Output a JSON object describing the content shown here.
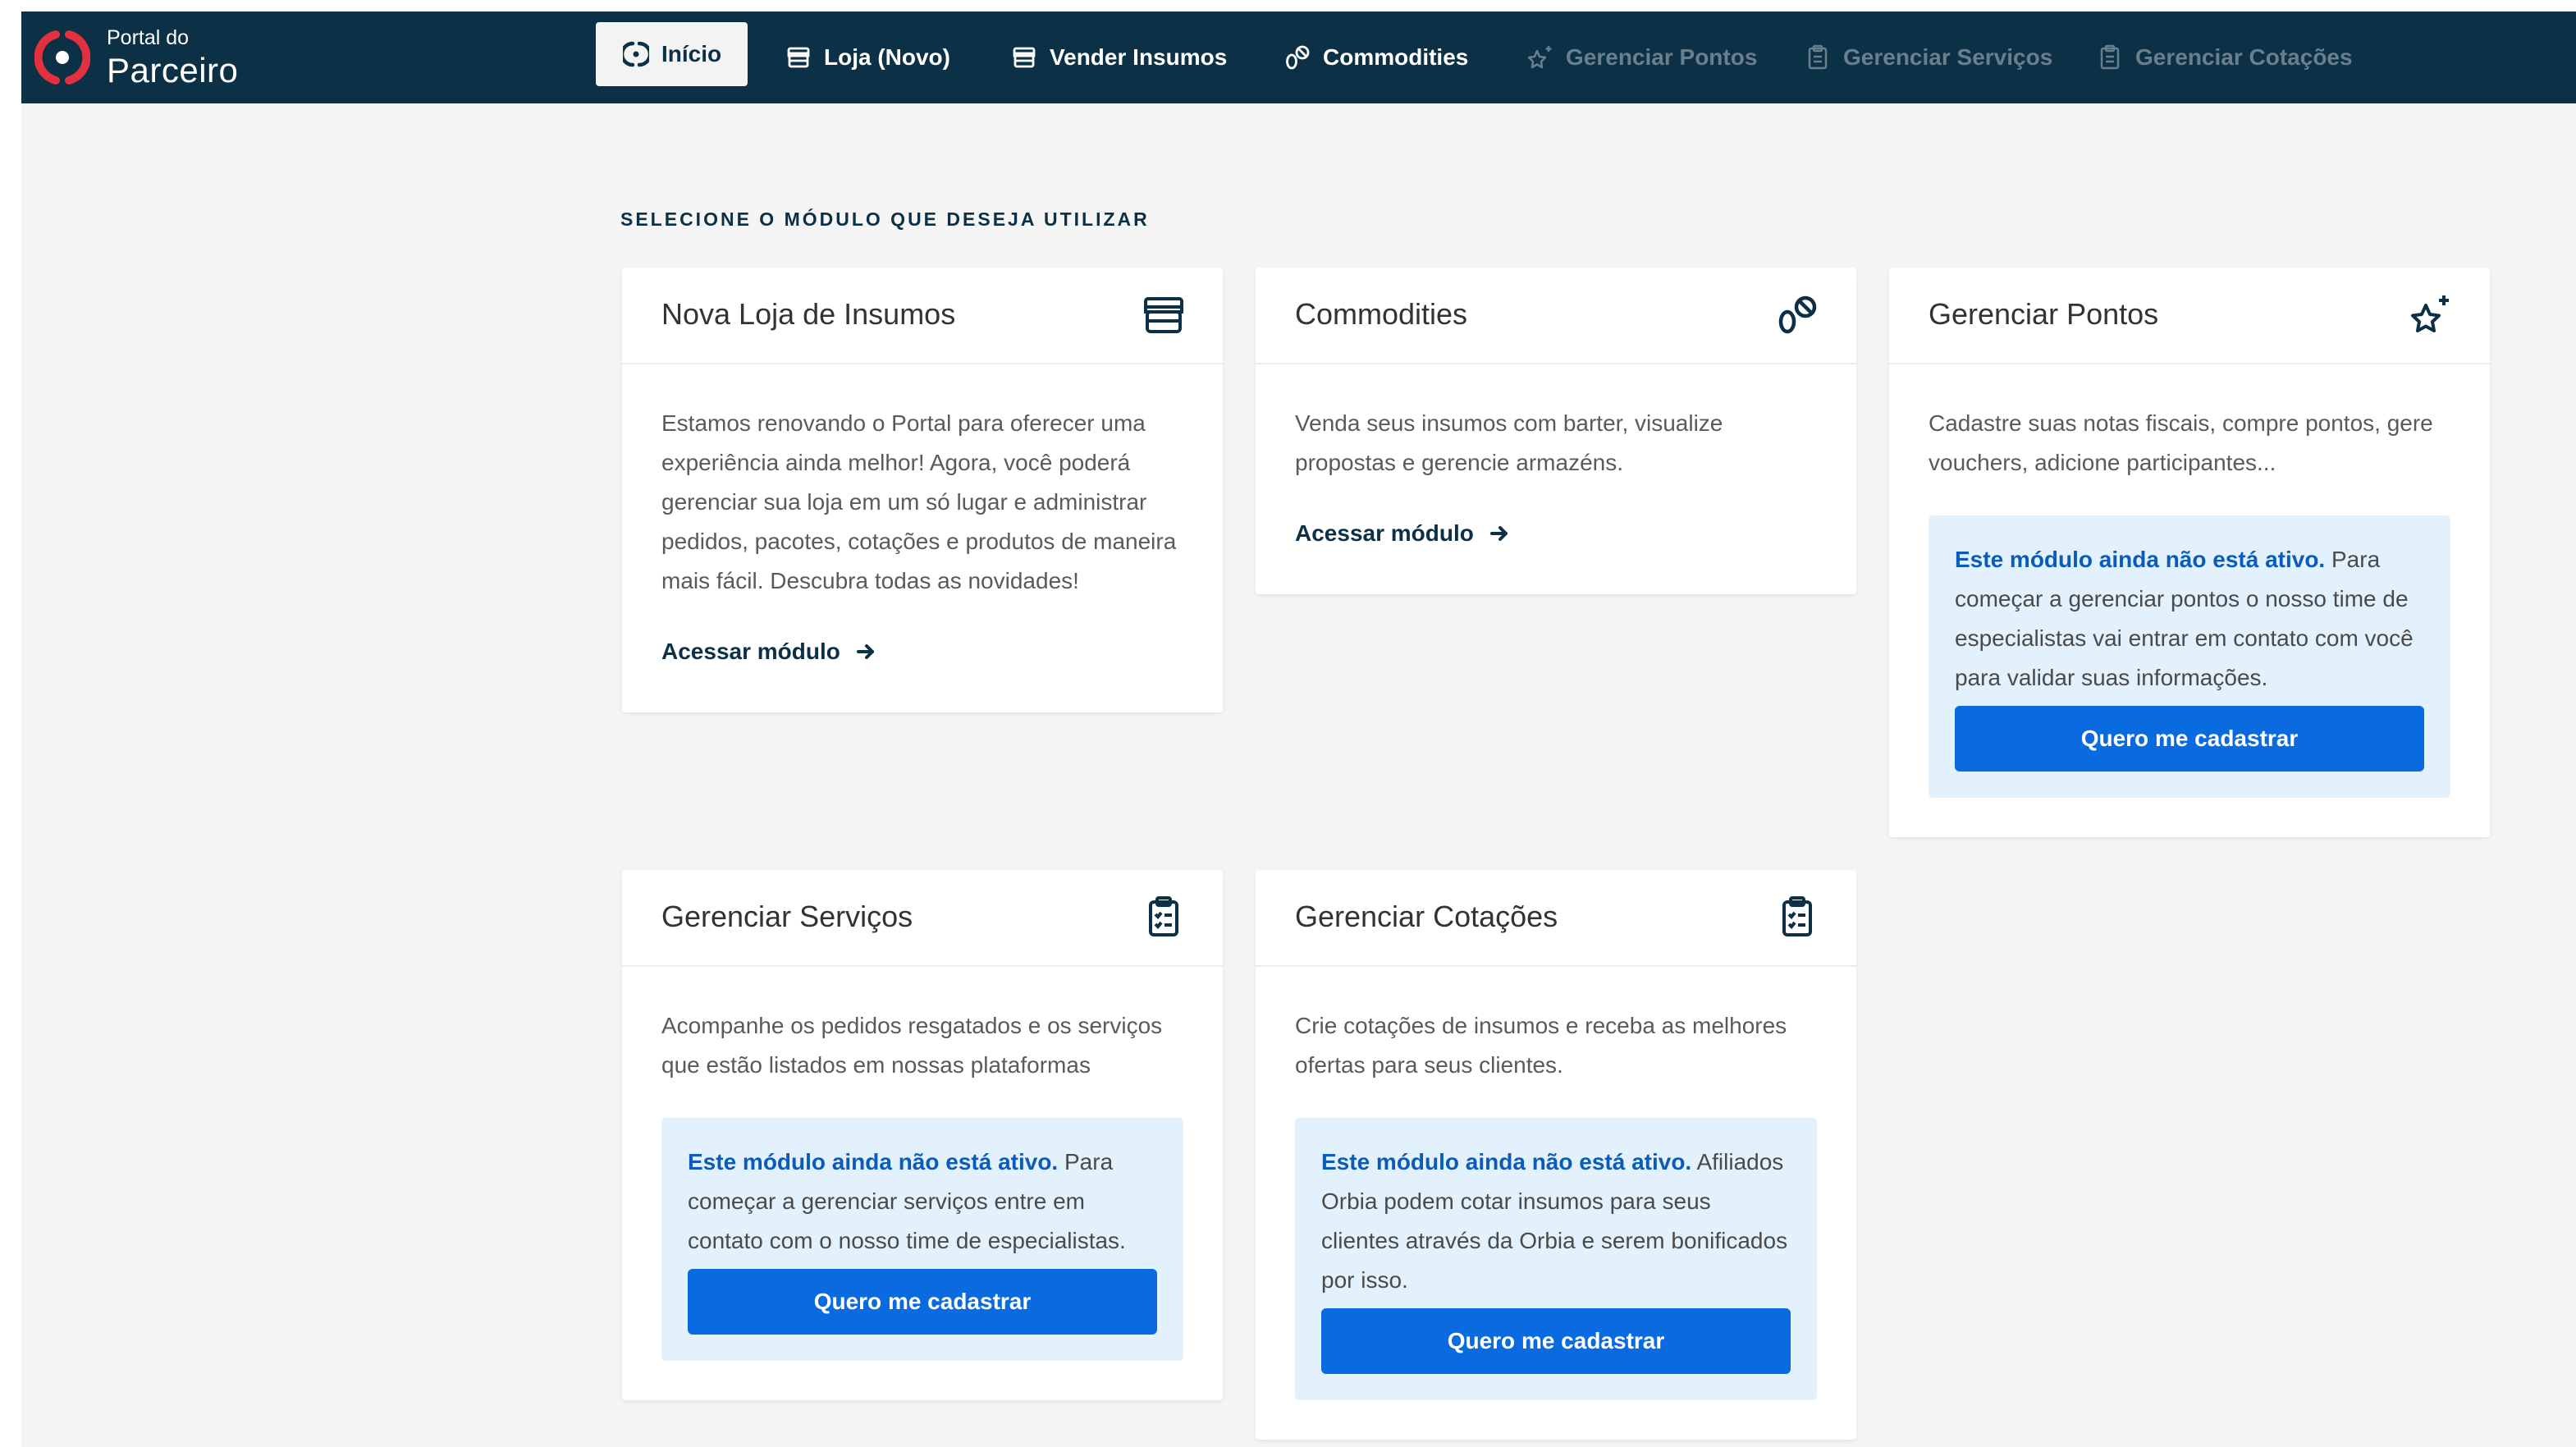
{
  "brand": {
    "small": "Portal do",
    "big": "Parceiro",
    "accent": "#e3303f",
    "nav_bg": "#0c3045"
  },
  "nav": {
    "items": [
      {
        "label": "Início",
        "icon": "orbia-logo-icon",
        "active": true
      },
      {
        "label": "Loja (Novo)",
        "icon": "store-icon"
      },
      {
        "label": "Vender Insumos",
        "icon": "store-icon"
      },
      {
        "label": "Commodities",
        "icon": "coins-icon"
      },
      {
        "label": "Gerenciar Pontos",
        "icon": "sparkle-star-icon",
        "disabled": true
      },
      {
        "label": "Gerenciar Serviços",
        "icon": "clipboard-icon",
        "disabled": true
      },
      {
        "label": "Gerenciar Cotações",
        "icon": "clipboard-icon",
        "disabled": true
      }
    ]
  },
  "main": {
    "section_title": "SELECIONE O MÓDULO QUE DESEJA UTILIZAR",
    "cards": {
      "loja": {
        "title": "Nova Loja de Insumos",
        "icon": "store-icon",
        "desc": "Estamos renovando o Portal para oferecer uma experiência ainda melhor! Agora, você poderá gerenciar sua loja em um só lugar e administrar pedidos, pacotes, cotações e produtos de maneira mais fácil. Descubra todas as novidades!",
        "link": "Acessar módulo"
      },
      "commodities": {
        "title": "Commodities",
        "icon": "coins-icon",
        "desc": "Venda seus insumos com barter, visualize propostas e gerencie armazéns.",
        "link": "Acessar módulo"
      },
      "pontos": {
        "title": "Gerenciar Pontos",
        "icon": "sparkle-star-icon",
        "desc": "Cadastre suas notas fiscais, compre pontos, gere vouchers, adicione participantes...",
        "notice_strong": "Este módulo ainda não está ativo.",
        "notice_text": " Para começar a gerenciar pontos o nosso time de especialistas vai entrar em contato com você para validar suas informações.",
        "cta": "Quero me cadastrar"
      },
      "servicos": {
        "title": "Gerenciar Serviços",
        "icon": "clipboard-icon",
        "desc": "Acompanhe os pedidos resgatados e os serviços que estão listados em nossas plataformas",
        "notice_strong": "Este módulo ainda não está ativo.",
        "notice_text": " Para começar a gerenciar serviços entre em contato com o nosso time de especialistas.",
        "cta": "Quero me cadastrar"
      },
      "cotacoes": {
        "title": "Gerenciar Cotações",
        "icon": "clipboard-icon",
        "desc": "Crie cotações de insumos e receba as melhores ofertas para seus clientes.",
        "notice_strong": "Este módulo ainda não está ativo.",
        "notice_text": " Afiliados Orbia podem cotar insumos para seus clientes através da Orbia e serem bonificados por isso.",
        "cta": "Quero me cadastrar"
      }
    }
  }
}
